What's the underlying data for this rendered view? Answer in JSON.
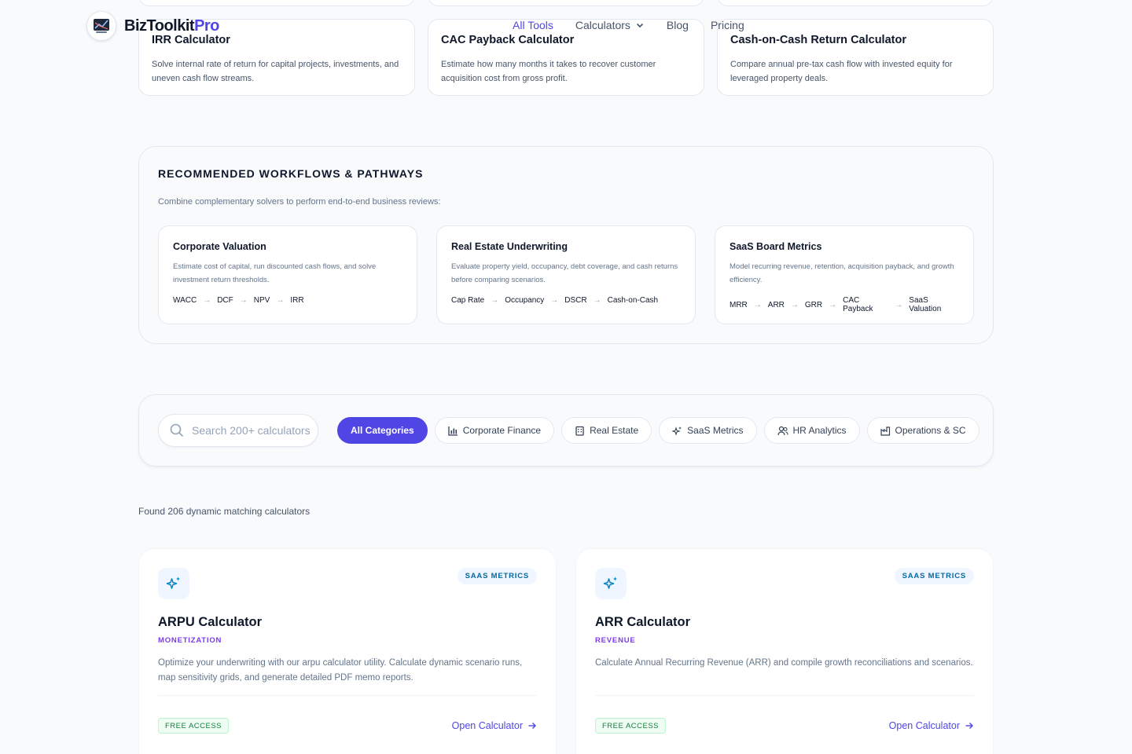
{
  "brand": {
    "name": "BizToolkit",
    "accent": "Pro",
    "logo_icon": "chart-logo-icon"
  },
  "nav": {
    "items": [
      {
        "label": "All Tools",
        "active": true
      },
      {
        "label": "Calculators",
        "dropdown": true
      },
      {
        "label": "Blog"
      },
      {
        "label": "Pricing"
      }
    ]
  },
  "tool_cards": [
    {
      "title": "IRR Calculator",
      "desc": "Solve internal rate of return for capital projects, investments, and uneven cash flow streams."
    },
    {
      "title": "CAC Payback Calculator",
      "desc": "Estimate how many months it takes to recover customer acquisition cost from gross profit."
    },
    {
      "title": "Cash-on-Cash Return Calculator",
      "desc": "Compare annual pre-tax cash flow with invested equity for leveraged property deals."
    }
  ],
  "workflows": {
    "title": "RECOMMENDED WORKFLOWS & PATHWAYS",
    "subtitle": "Combine complementary solvers to perform end-to-end business reviews:",
    "items": [
      {
        "name": "Corporate Valuation",
        "desc": "Estimate cost of capital, run discounted cash flows, and solve investment return thresholds.",
        "steps": [
          "WACC",
          "DCF",
          "NPV",
          "IRR"
        ]
      },
      {
        "name": "Real Estate Underwriting",
        "desc": "Evaluate property yield, occupancy, debt coverage, and cash returns before comparing scenarios.",
        "steps": [
          "Cap Rate",
          "Occupancy",
          "DSCR",
          "Cash-on-Cash"
        ]
      },
      {
        "name": "SaaS Board Metrics",
        "desc": "Model recurring revenue, retention, acquisition payback, and growth efficiency.",
        "steps": [
          "MRR",
          "ARR",
          "GRR",
          "CAC Payback",
          "SaaS Valuation"
        ]
      }
    ]
  },
  "search": {
    "placeholder": "Search 200+ calculators",
    "value": ""
  },
  "categories": [
    {
      "label": "All Categories",
      "active": true,
      "icon": ""
    },
    {
      "label": "Corporate Finance",
      "icon": "bar-chart-icon"
    },
    {
      "label": "Real Estate",
      "icon": "building-icon"
    },
    {
      "label": "SaaS Metrics",
      "icon": "sparkles-icon"
    },
    {
      "label": "HR Analytics",
      "icon": "users-icon"
    },
    {
      "label": "Operations & SC",
      "icon": "factory-icon"
    }
  ],
  "results": {
    "count_text": "Found 206 dynamic matching calculators",
    "items": [
      {
        "badge": "SAAS METRICS",
        "title": "ARPU Calculator",
        "subcategory": "MONETIZATION",
        "desc": "Optimize your underwriting with our arpu calculator utility. Calculate dynamic scenario runs, map sensitivity grids, and generate detailed PDF memo reports.",
        "access": "FREE ACCESS",
        "cta": "Open Calculator",
        "icon": "sparkles-icon"
      },
      {
        "badge": "SAAS METRICS",
        "title": "ARR Calculator",
        "subcategory": "REVENUE",
        "desc": "Calculate Annual Recurring Revenue (ARR) and compile growth reconciliations and scenarios.",
        "access": "FREE ACCESS",
        "cta": "Open Calculator",
        "icon": "sparkles-icon"
      }
    ]
  },
  "colors": {
    "accent": "#4f46e5",
    "badge_text": "#0369a1",
    "free_text": "#15803d",
    "background": "#f8fafc"
  }
}
